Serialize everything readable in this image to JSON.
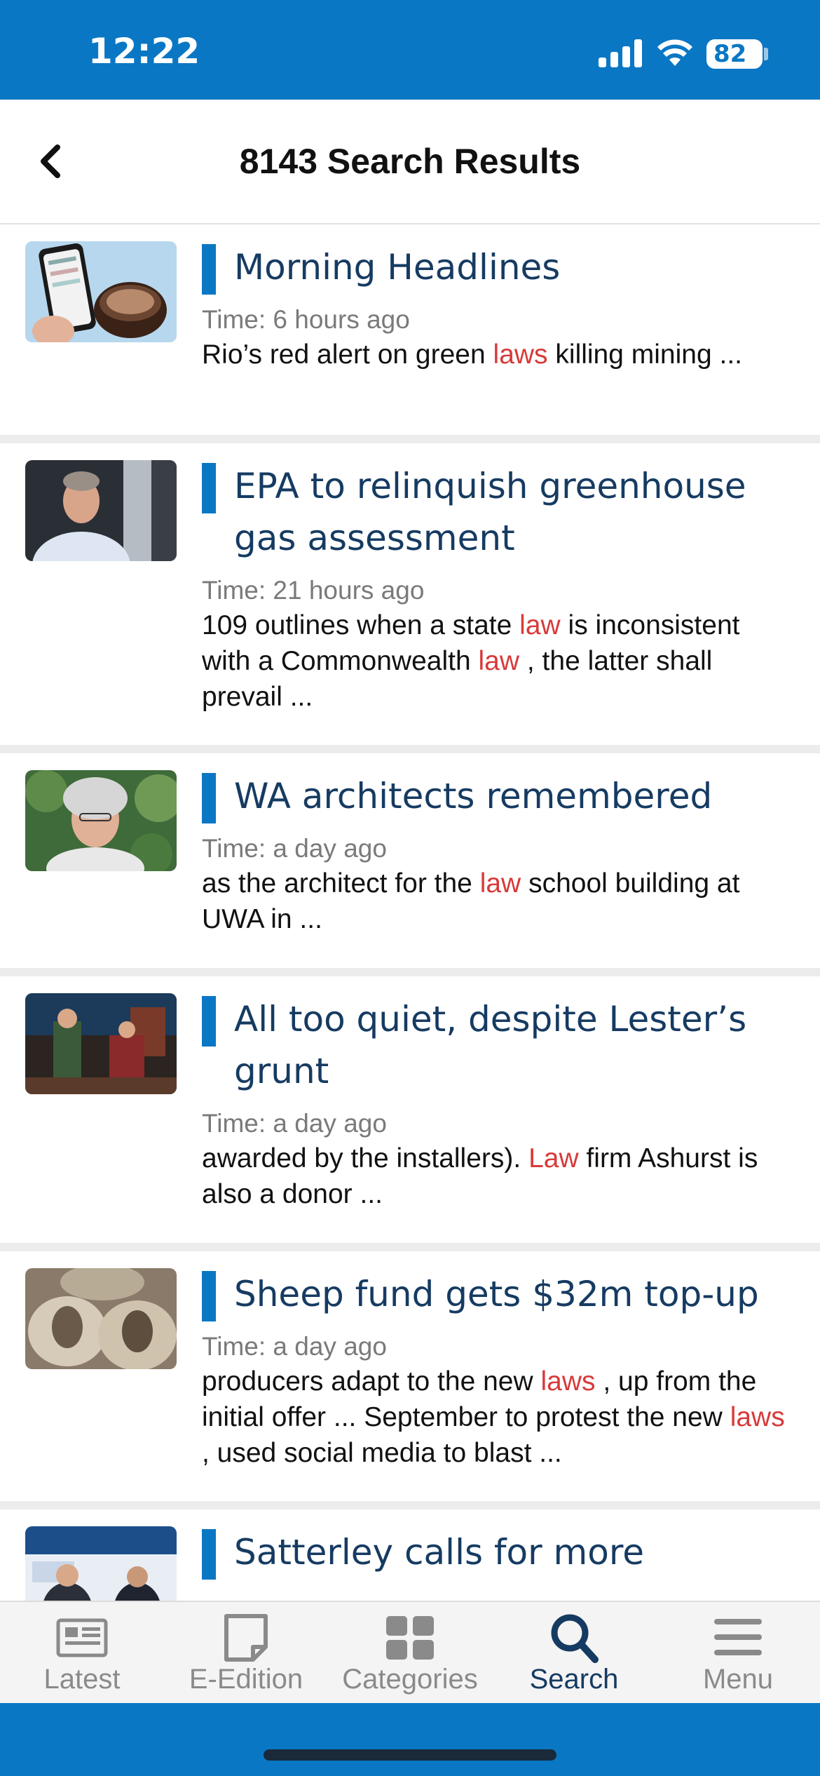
{
  "status": {
    "time": "12:22",
    "battery": "82"
  },
  "header": {
    "title": "8143 Search Results"
  },
  "results": [
    {
      "headline": "Morning Headlines",
      "time": "Time: 6 hours ago",
      "snippet": [
        {
          "t": "Rio’s red alert on green ",
          "h": false
        },
        {
          "t": "laws",
          "h": true
        },
        {
          "t": " killing mining ...",
          "h": false
        }
      ]
    },
    {
      "headline": "EPA to relinquish greenhouse gas assessment",
      "time": "Time: 21 hours ago",
      "snippet": [
        {
          "t": "109 outlines when a state ",
          "h": false
        },
        {
          "t": "law",
          "h": true
        },
        {
          "t": " is inconsistent with a Commonwealth ",
          "h": false
        },
        {
          "t": "law",
          "h": true
        },
        {
          "t": " , the latter shall prevail ...",
          "h": false
        }
      ]
    },
    {
      "headline": "WA architects remembered",
      "time": "Time: a day ago",
      "snippet": [
        {
          "t": "as the architect for the ",
          "h": false
        },
        {
          "t": "law",
          "h": true
        },
        {
          "t": " school building at UWA in ...",
          "h": false
        }
      ]
    },
    {
      "headline": "All too quiet, despite Lester’s grunt",
      "time": "Time: a day ago",
      "snippet": [
        {
          "t": "awarded by the installers). ",
          "h": false
        },
        {
          "t": "Law",
          "h": true
        },
        {
          "t": " firm Ashurst is also a donor ...",
          "h": false
        }
      ]
    },
    {
      "headline": "Sheep fund gets $32m top-up",
      "time": "Time: a day ago",
      "snippet": [
        {
          "t": "producers adapt to the new ",
          "h": false
        },
        {
          "t": "laws",
          "h": true
        },
        {
          "t": " , up from the initial offer ... September to protest the new ",
          "h": false
        },
        {
          "t": "laws",
          "h": true
        },
        {
          "t": " , used social media to blast ...",
          "h": false
        }
      ]
    },
    {
      "headline": "Satterley calls for more",
      "time": "",
      "snippet": []
    }
  ],
  "tabs": [
    {
      "label": "Latest",
      "icon": "newspaper-icon",
      "active": false
    },
    {
      "label": "E-Edition",
      "icon": "page-icon",
      "active": false
    },
    {
      "label": "Categories",
      "icon": "grid-icon",
      "active": false
    },
    {
      "label": "Search",
      "icon": "search-icon",
      "active": true
    },
    {
      "label": "Menu",
      "icon": "menu-icon",
      "active": false
    }
  ],
  "colors": {
    "accent": "#0a77c4",
    "highlight": "#d83a3a",
    "headline": "#163b62"
  }
}
